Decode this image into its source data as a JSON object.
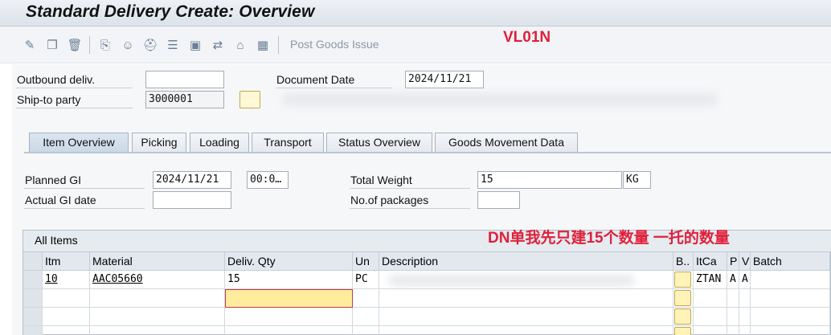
{
  "title": "Standard Delivery  Create: Overview",
  "toolbar": {
    "icons": [
      "edit-icon",
      "copy-icon",
      "trash-icon",
      "pick-icon",
      "partner-icon",
      "hat-icon",
      "texts-icon",
      "box-icon",
      "handover-icon",
      "home-icon",
      "grid-icon"
    ],
    "post_goods_issue": "Post Goods Issue"
  },
  "annotations": {
    "tcode": "VL01N",
    "note": "DN单我先只建15个数量 一托的数量"
  },
  "header": {
    "outbound_label": "Outbound deliv.",
    "outbound_value": "",
    "shipto_label": "Ship-to party",
    "shipto_value": "3000001",
    "docdate_label": "Document Date",
    "docdate_value": "2024/11/21"
  },
  "tabs": [
    {
      "label": "Item Overview",
      "active": true
    },
    {
      "label": "Picking"
    },
    {
      "label": "Loading"
    },
    {
      "label": "Transport"
    },
    {
      "label": "Status Overview"
    },
    {
      "label": "Goods Movement Data"
    }
  ],
  "overview": {
    "planned_gi_label": "Planned GI",
    "planned_gi_date": "2024/11/21",
    "planned_gi_time": "00:0…",
    "actual_gi_label": "Actual GI date",
    "actual_gi_value": "",
    "total_weight_label": "Total Weight",
    "total_weight_value": "15",
    "weight_unit": "KG",
    "packages_label": "No.of packages",
    "packages_value": ""
  },
  "items": {
    "title": "All Items",
    "columns": [
      "Itm",
      "Material",
      "Deliv. Qty",
      "Un",
      "Description",
      "B..",
      "ItCa",
      "P",
      "V",
      "Batch"
    ],
    "rows": [
      {
        "itm": "10",
        "material": "AAC05660",
        "qty": "15",
        "un": "PC",
        "description": "",
        "itca": "ZTAN",
        "p": "A",
        "v": "A",
        "batch": ""
      }
    ]
  }
}
